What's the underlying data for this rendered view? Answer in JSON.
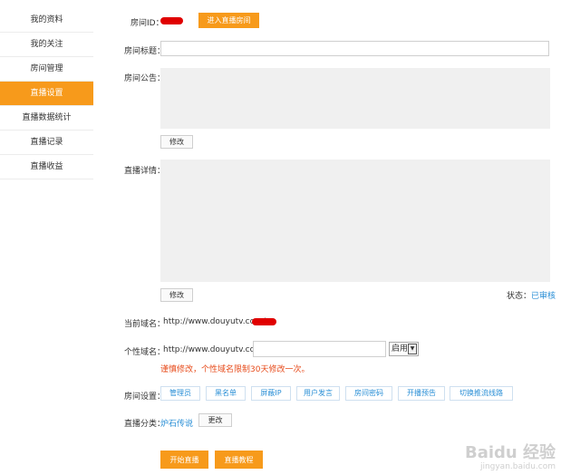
{
  "sidebar": {
    "items": [
      {
        "label": "我的资料"
      },
      {
        "label": "我的关注"
      },
      {
        "label": "房间管理"
      },
      {
        "label": "直播设置",
        "active": true
      },
      {
        "label": "直播数据统计"
      },
      {
        "label": "直播记录"
      },
      {
        "label": "直播收益"
      }
    ]
  },
  "room": {
    "id_label": "房间ID：",
    "enter_button": "进入直播房间",
    "title_label": "房间标题：",
    "title_value": "",
    "notice_label": "房间公告：",
    "notice_value": "",
    "modify_button": "修改",
    "detail_label": "直播详情：",
    "detail_value": "",
    "status_label": "状态：",
    "status_value": "已审核"
  },
  "domain": {
    "current_label": "当前域名：",
    "current_value": "http://www.douyutv.com/",
    "custom_label": "个性域名：",
    "custom_value": "http://www.douyutv.com/",
    "custom_select": "启用",
    "warning": "谨慎修改，个性域名限制30天修改一次。"
  },
  "settings": {
    "label": "房间设置：",
    "buttons": [
      "管理员",
      "黑名单",
      "屏蔽IP",
      "用户发言",
      "房间密码",
      "开播预告",
      "切换推流线路"
    ]
  },
  "category": {
    "label": "直播分类：",
    "value": "炉石传说",
    "change_button": "更改"
  },
  "actions": {
    "start": "开始直播",
    "tutorial": "直播教程"
  },
  "watermark": {
    "title": "Baidu 经验",
    "url": "jingyan.baidu.com"
  },
  "colors": {
    "accent": "#f79a1b",
    "link": "#2a8fd6",
    "warning": "#e74c1c"
  }
}
